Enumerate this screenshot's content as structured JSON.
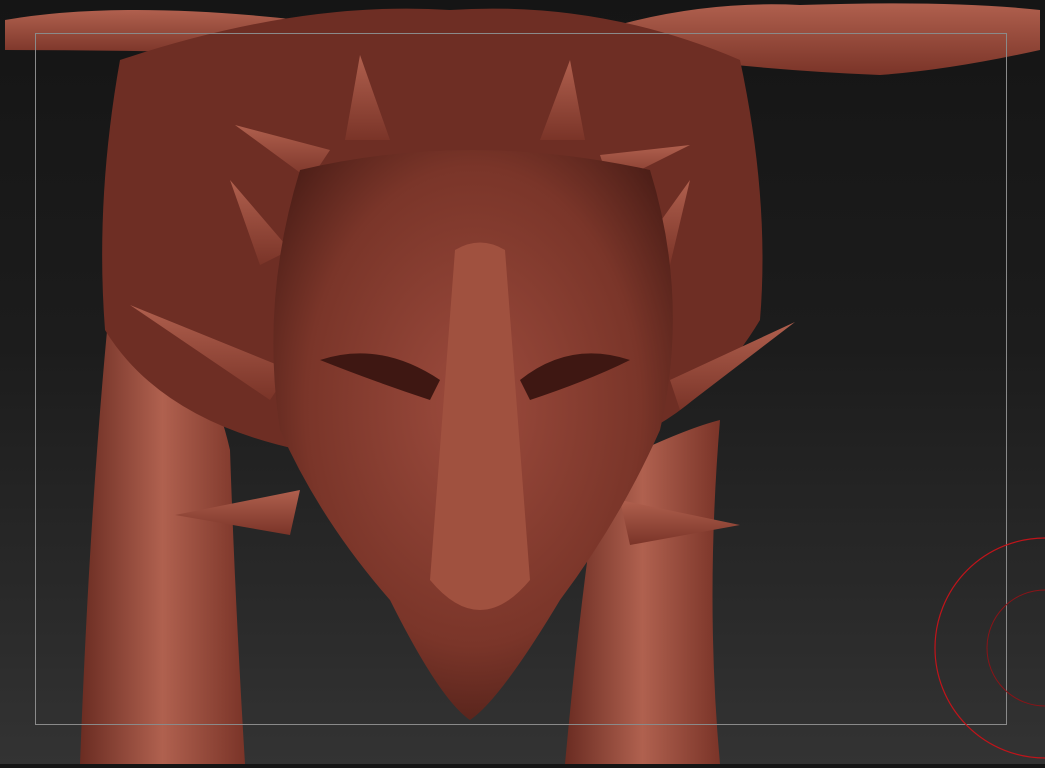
{
  "viewport": {
    "model_color": "#8c4236",
    "model_highlight": "#b86a58",
    "model_shadow": "#4a1e18",
    "brush_cursor_color": "#c0141a",
    "frame_color": "#8a8a8a"
  }
}
